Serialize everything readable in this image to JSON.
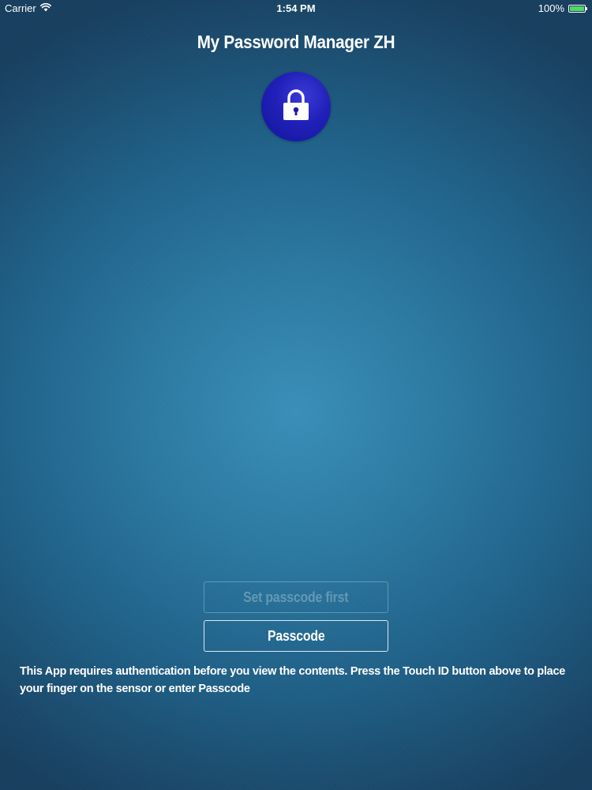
{
  "status_bar": {
    "carrier": "Carrier",
    "wifi_icon": "wifi-icon",
    "time": "1:54 PM",
    "battery_percent": "100%",
    "battery_level": 1.0,
    "battery_color": "#4cd964"
  },
  "app": {
    "title": "My Password Manager ZH",
    "lock_icon": "lock-icon",
    "badge_color": "#2020b8"
  },
  "buttons": {
    "set_passcode_label": "Set passcode first",
    "set_passcode_enabled": false,
    "passcode_label": "Passcode"
  },
  "message": {
    "text": "This App requires authentication before you view the contents. Press the Touch ID button above to place your finger on the sensor or enter Passcode"
  },
  "theme": {
    "background_center": "#3a8fb9",
    "background_edge": "#183f5f",
    "text_color": "#ffffff"
  }
}
